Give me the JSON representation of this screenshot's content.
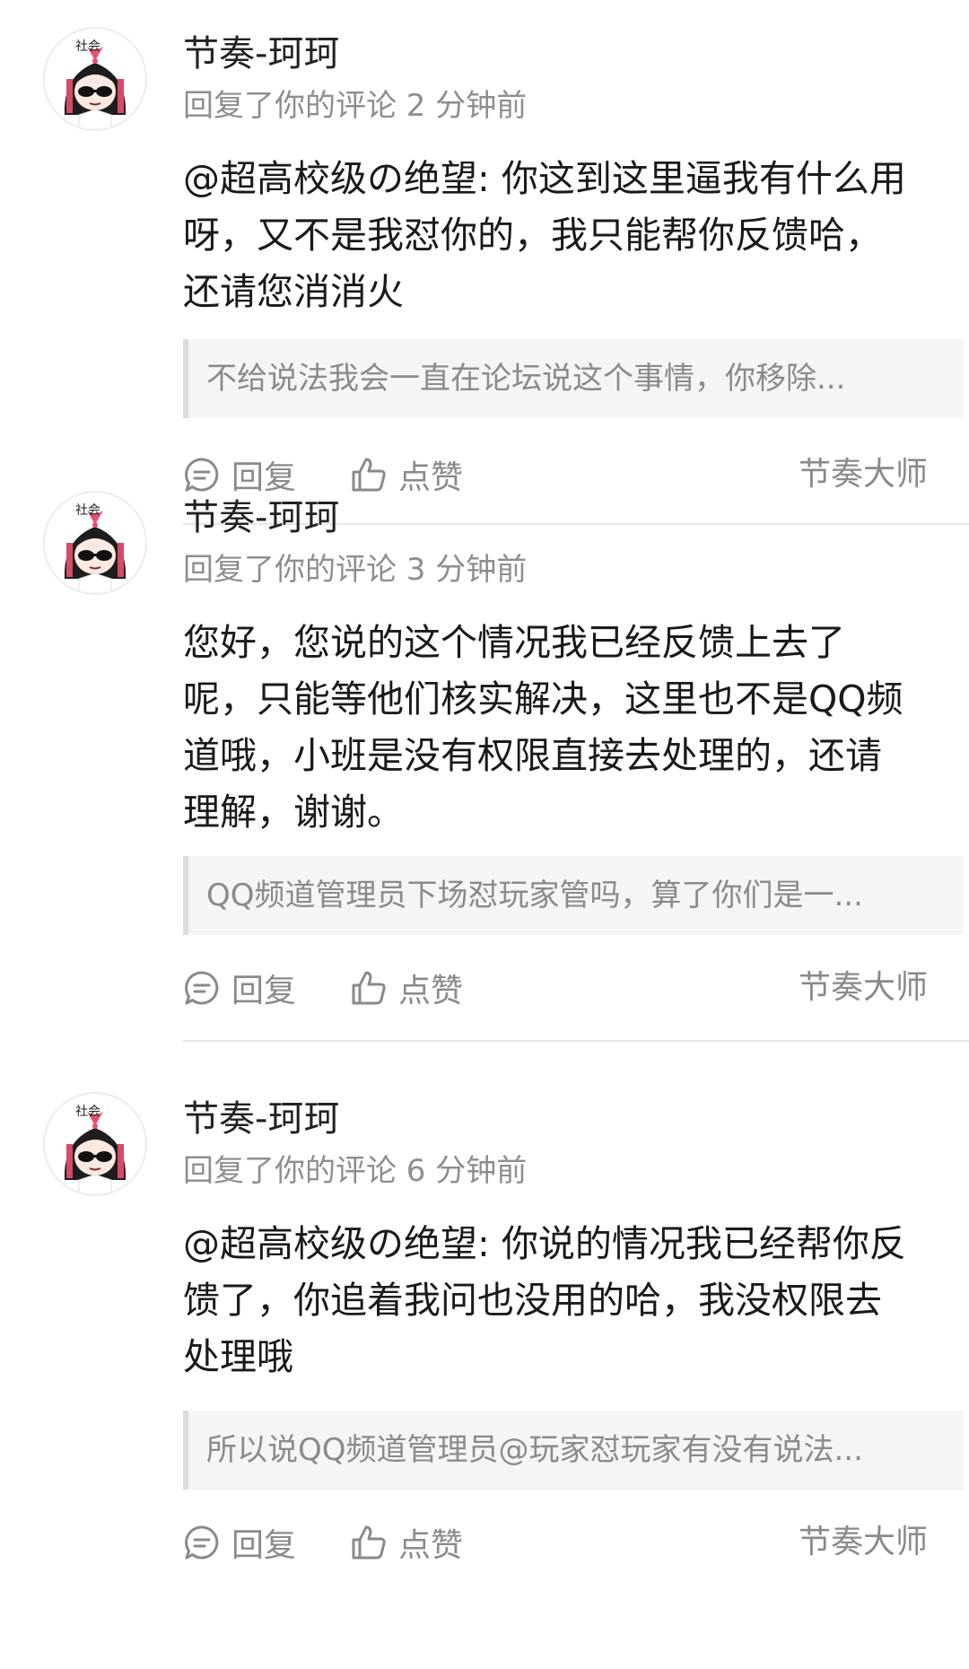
{
  "comments": [
    {
      "username": "节奏-珂珂",
      "meta": "回复了你的评论 2 分钟前",
      "lines": [
        "@超高校级の绝望: 你这到这里逼我有什么用",
        "呀，又不是我怼你的，我只能帮你反馈哈，",
        "还请您消消火"
      ],
      "quote": "不给说法我会一直在论坛说这个事情，你移除...",
      "reply_label": "回复",
      "like_label": "点赞",
      "source": "节奏大师"
    },
    {
      "username": "节奏-珂珂",
      "meta": "回复了你的评论 3 分钟前",
      "lines": [
        "您好，您说的这个情况我已经反馈上去了",
        "呢，只能等他们核实解决，这里也不是QQ频",
        "道哦，小班是没有权限直接去处理的，还请",
        "理解，谢谢。"
      ],
      "quote": "QQ频道管理员下场怼玩家管吗，算了你们是一...",
      "reply_label": "回复",
      "like_label": "点赞",
      "source": "节奏大师"
    },
    {
      "username": "节奏-珂珂",
      "meta": "回复了你的评论 6 分钟前",
      "lines": [
        "@超高校级の绝望: 你说的情况我已经帮你反",
        "馈了，你追着我问也没用的哈，我没权限去",
        "处理哦"
      ],
      "quote": "所以说QQ频道管理员@玩家怼玩家有没有说法...",
      "reply_label": "回复",
      "like_label": "点赞",
      "source": "节奏大师"
    }
  ],
  "avatar_badge_text": "社会",
  "icons": {
    "reply": "comment-bubble-icon",
    "like": "thumbs-up-icon"
  },
  "colors": {
    "text": "#1a1a1a",
    "secondary": "#8a8a8a",
    "quote_bg": "#f5f5f5",
    "divider": "#e6e6e6"
  }
}
